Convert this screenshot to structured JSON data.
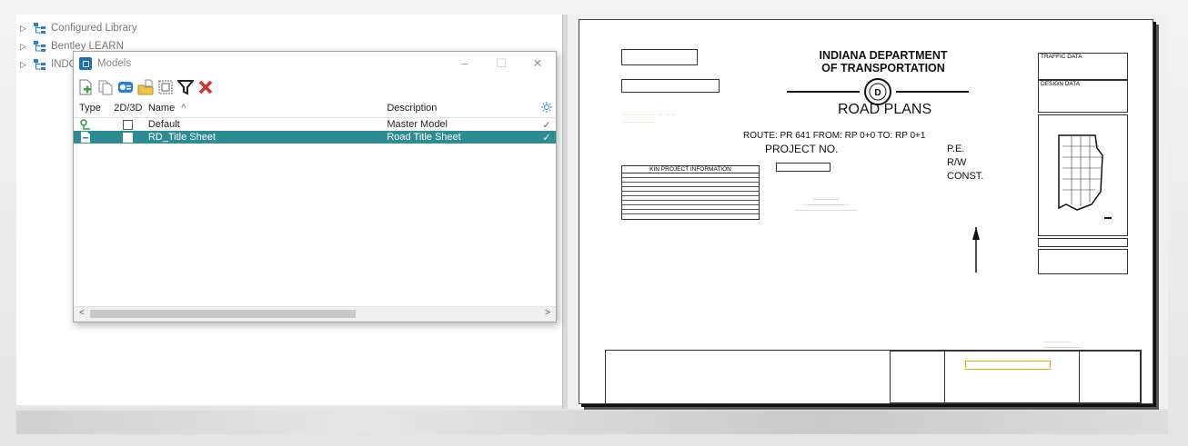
{
  "tree": {
    "items": [
      {
        "label": "Configured Library"
      },
      {
        "label": "Bentley LEARN"
      },
      {
        "label": "INDOT"
      }
    ]
  },
  "dialog": {
    "title": "Models",
    "columns": {
      "type": "Type",
      "dim": "2D/3D",
      "name": "Name",
      "sort": "^",
      "description": "Description"
    },
    "rows": [
      {
        "name": "Default",
        "description": "Master Model",
        "check": "✓"
      },
      {
        "name": "RD_Title Sheet",
        "description": "Road Title Sheet",
        "check": "✓"
      }
    ]
  },
  "sheet": {
    "agency_line1": "INDIANA DEPARTMENT",
    "agency_line2": "OF TRANSPORTATION",
    "plan_title": "ROAD PLANS",
    "route_line": "ROUTE:  PR 641   FROM:  RP      0+0        TO:  RP       0+1",
    "project_no": "PROJECT NO.",
    "pe": "P.E.",
    "rw": "R/W",
    "const": "CONST.",
    "kin_title": "KIN PROJECT INFORMATION",
    "traffic_data": "TRAFFIC DATA",
    "design_data": "DESIGN DATA"
  },
  "colors": {
    "selection": "#2d8b92",
    "delete": "#d32f2f",
    "accent": "#1b6fb5"
  }
}
